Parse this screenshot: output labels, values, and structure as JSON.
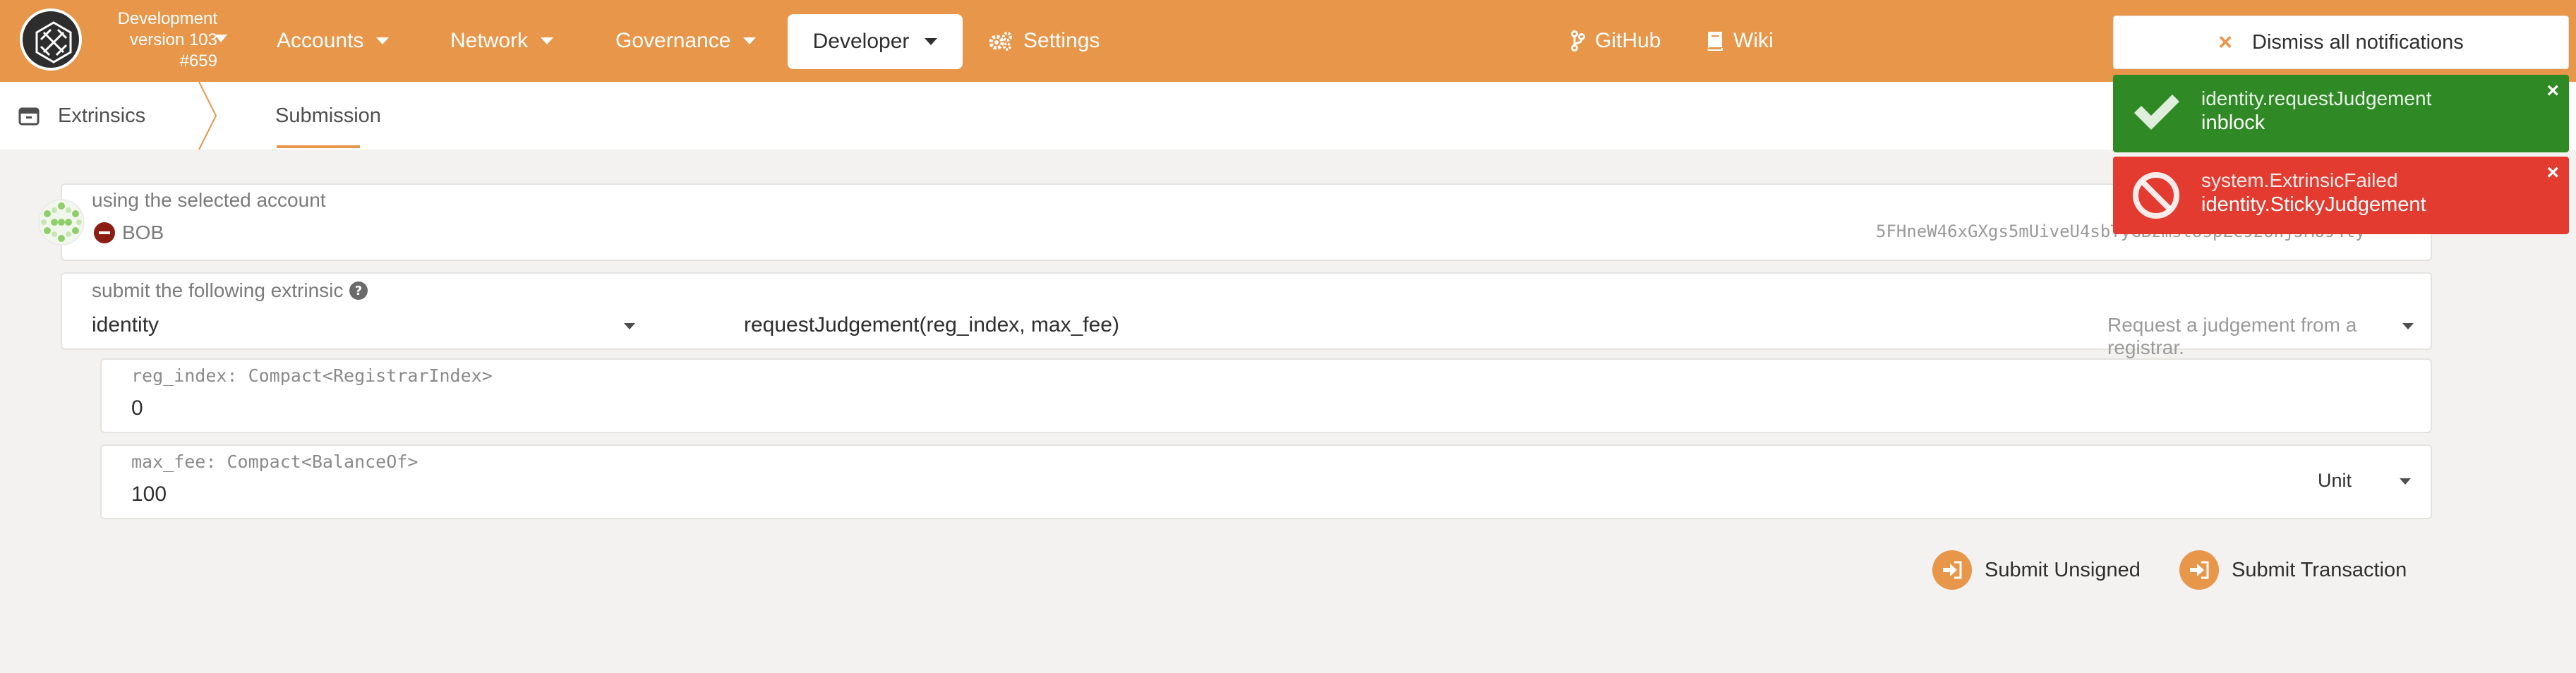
{
  "chain": {
    "name": "Development",
    "version": "version 103",
    "block": "#659"
  },
  "nav": {
    "accounts": "Accounts",
    "network": "Network",
    "governance": "Governance",
    "developer": "Developer",
    "settings": "Settings",
    "github": "GitHub",
    "wiki": "Wiki"
  },
  "tabs": {
    "root": "Extrinsics",
    "active": "Submission"
  },
  "account": {
    "label": "using the selected account",
    "name": "BOB",
    "address": "5FHneW46xGXgs5mUiveU4sbTyGBzmstUspZC92UhjJM694ty"
  },
  "extrinsic": {
    "label": "submit the following extrinsic",
    "module": "identity",
    "method": "requestJudgement(reg_index, max_fee)",
    "description": "Request a judgement from a registrar."
  },
  "params": {
    "reg_index_label": "reg_index: Compact<RegistrarIndex>",
    "reg_index_value": "0",
    "max_fee_label": "max_fee: Compact<BalanceOf>",
    "max_fee_value": "100",
    "unit": "Unit"
  },
  "actions": {
    "submit_unsigned": "Submit Unsigned",
    "submit_transaction": "Submit Transaction"
  },
  "notifications": {
    "dismiss_all": "Dismiss all notifications",
    "success": {
      "title": "identity.requestJudgement",
      "status": "inblock",
      "color": "#2f8a25"
    },
    "error": {
      "title": "system.ExtrinsicFailed",
      "status": "identity.StickyJudgement",
      "color": "#e33b2f"
    }
  },
  "colors": {
    "accent": "#e8964a",
    "background": "#f3f2f0"
  }
}
